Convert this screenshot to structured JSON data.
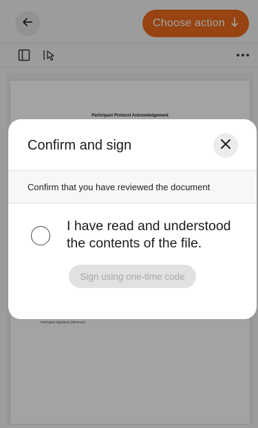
{
  "header": {
    "back_icon": "arrow-left-icon",
    "action_label": "Choose action",
    "action_icon": "arrow-down-icon",
    "accent_color": "#ec6a1d"
  },
  "toolbar": {
    "sidebar_icon": "sidebar-panel-icon",
    "select_icon": "select-cursor-icon",
    "more_icon": "more-horizontal-icon"
  },
  "document": {
    "title": "Participant Protocol Acknowledgement",
    "signature_label": "Participant Signature (electronic)"
  },
  "modal": {
    "title": "Confirm and sign",
    "close_icon": "close-icon",
    "notice": "Confirm that you have reviewed the document",
    "confirm_label": "I have read and understood the contents of the file.",
    "confirm_checked": false,
    "sign_button_label": "Sign using one-time code",
    "sign_button_enabled": false
  }
}
